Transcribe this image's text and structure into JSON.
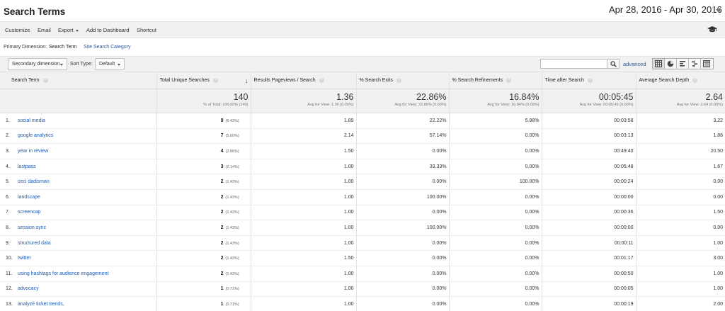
{
  "header": {
    "title": "Search Terms",
    "date_range": "Apr 28, 2016 - Apr 30, 2016"
  },
  "toolbar": {
    "customize": "Customize",
    "email": "Email",
    "export": "Export",
    "add_to_dashboard": "Add to Dashboard",
    "shortcut": "Shortcut"
  },
  "primary_dimension": {
    "label": "Primary Dimension:",
    "current": "Search Term",
    "alternative": "Site Search Category"
  },
  "controls": {
    "secondary_dimension": "Secondary dimension",
    "sort_type_label": "Sort Type:",
    "sort_type_value": "Default",
    "advanced": "advanced"
  },
  "table": {
    "columns": [
      "Search Term",
      "Total Unique Searches",
      "Results Pageviews / Search",
      "% Search Exits",
      "% Search Refinements",
      "Time after Search",
      "Average Search Depth"
    ],
    "summary": {
      "unique": {
        "value": "140",
        "sub": "% of Total: 100.00% (140)"
      },
      "pageviews": {
        "value": "1.36",
        "sub": "Avg for View: 1.36 (0.00%)"
      },
      "exits": {
        "value": "22.86%",
        "sub": "Avg for View: 22.86% (0.00%)"
      },
      "refinements": {
        "value": "16.84%",
        "sub": "Avg for View: 16.84% (0.00%)"
      },
      "time": {
        "value": "00:05:45",
        "sub": "Avg for View: 00:05:45 (0.00%)"
      },
      "depth": {
        "value": "2.64",
        "sub": "Avg for View: 2.64 (0.00%)"
      }
    },
    "rows": [
      {
        "num": "1.",
        "term": "social media",
        "unique": "9",
        "pct": "(6.43%)",
        "pageviews": "1.89",
        "exits": "22.22%",
        "refinements": "5.88%",
        "time": "00:03:58",
        "depth": "3.22"
      },
      {
        "num": "2.",
        "term": "google analytics",
        "unique": "7",
        "pct": "(5.00%)",
        "pageviews": "2.14",
        "exits": "57.14%",
        "refinements": "0.00%",
        "time": "00:03:13",
        "depth": "1.86"
      },
      {
        "num": "3.",
        "term": "year in review",
        "unique": "4",
        "pct": "(2.86%)",
        "pageviews": "1.50",
        "exits": "0.00%",
        "refinements": "0.00%",
        "time": "00:49:40",
        "depth": "20.50"
      },
      {
        "num": "4.",
        "term": "lastpass",
        "unique": "3",
        "pct": "(2.14%)",
        "pageviews": "1.00",
        "exits": "33.33%",
        "refinements": "0.00%",
        "time": "00:05:48",
        "depth": "1.67"
      },
      {
        "num": "5.",
        "term": "ceci dadisman",
        "unique": "2",
        "pct": "(1.43%)",
        "pageviews": "1.00",
        "exits": "0.00%",
        "refinements": "100.00%",
        "time": "00:00:24",
        "depth": "0.00"
      },
      {
        "num": "6.",
        "term": "landscape",
        "unique": "2",
        "pct": "(1.43%)",
        "pageviews": "1.00",
        "exits": "100.00%",
        "refinements": "0.00%",
        "time": "00:00:00",
        "depth": "0.00"
      },
      {
        "num": "7.",
        "term": "screencap",
        "unique": "2",
        "pct": "(1.43%)",
        "pageviews": "1.00",
        "exits": "0.00%",
        "refinements": "0.00%",
        "time": "00:00:36",
        "depth": "1.50"
      },
      {
        "num": "8.",
        "term": "session sync",
        "unique": "2",
        "pct": "(1.43%)",
        "pageviews": "1.00",
        "exits": "100.00%",
        "refinements": "0.00%",
        "time": "00:00:00",
        "depth": "0.00"
      },
      {
        "num": "9.",
        "term": "structured data",
        "unique": "2",
        "pct": "(1.43%)",
        "pageviews": "1.00",
        "exits": "0.00%",
        "refinements": "0.00%",
        "time": "00:00:11",
        "depth": "1.00"
      },
      {
        "num": "10.",
        "term": "twitter",
        "unique": "2",
        "pct": "(1.43%)",
        "pageviews": "1.50",
        "exits": "0.00%",
        "refinements": "0.00%",
        "time": "00:01:17",
        "depth": "3.00"
      },
      {
        "num": "11.",
        "term": "using hashtags for audience engagement",
        "unique": "2",
        "pct": "(1.43%)",
        "pageviews": "1.00",
        "exits": "0.00%",
        "refinements": "0.00%",
        "time": "00:00:50",
        "depth": "1.00"
      },
      {
        "num": "12.",
        "term": "advocacy",
        "unique": "1",
        "pct": "(0.71%)",
        "pageviews": "1.00",
        "exits": "0.00%",
        "refinements": "0.00%",
        "time": "00:00:05",
        "depth": "1.00"
      },
      {
        "num": "13.",
        "term": "analyze ticket trends,",
        "unique": "1",
        "pct": "(0.71%)",
        "pageviews": "1.00",
        "exits": "0.00%",
        "refinements": "0.00%",
        "time": "00:00:19",
        "depth": "2.00"
      }
    ]
  }
}
